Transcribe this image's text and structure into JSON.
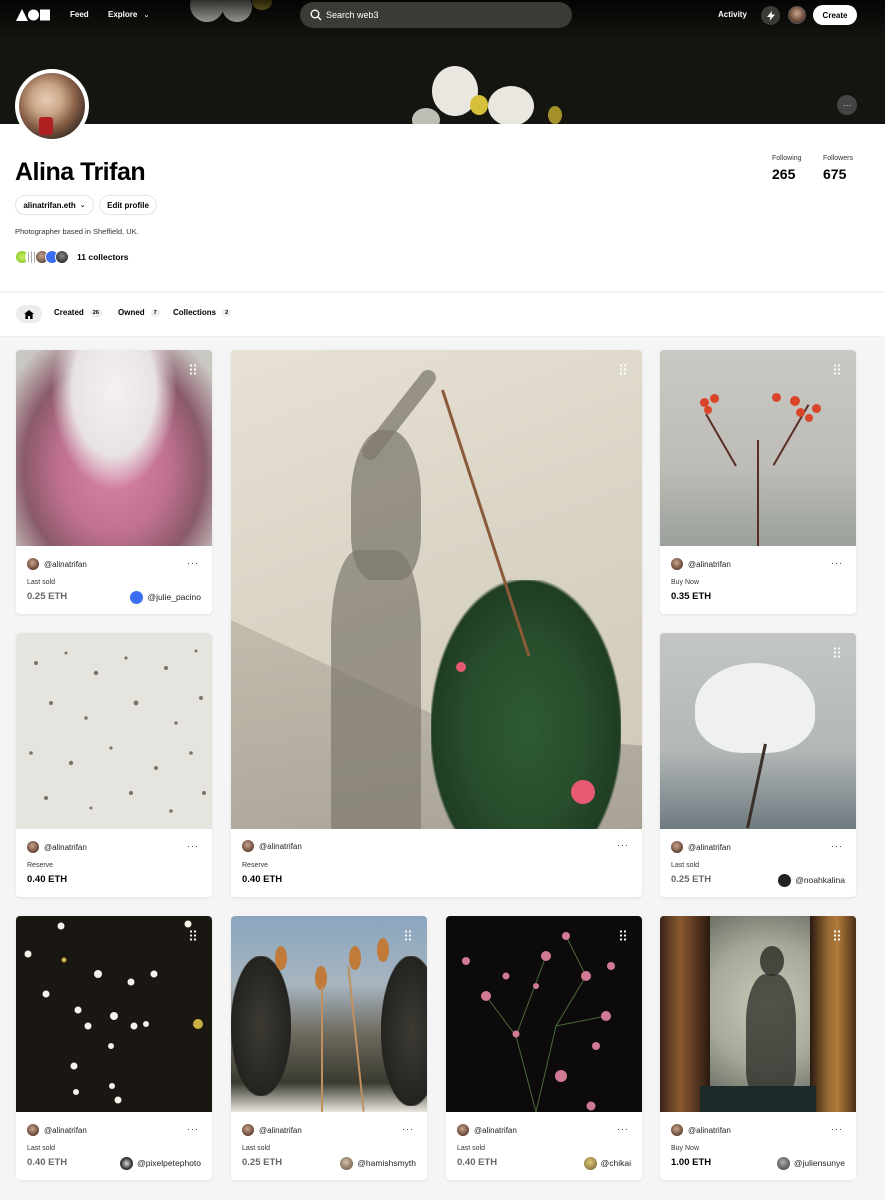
{
  "nav": {
    "feed": "Feed",
    "explore": "Explore",
    "search_placeholder": "Search web3",
    "activity": "Activity",
    "create": "Create"
  },
  "profile": {
    "name": "Alina Trifan",
    "ens": "alinatrifan.eth",
    "edit_profile": "Edit profile",
    "bio": "Photographer based in Sheffield, UK.",
    "collectors": "11 collectors",
    "following_label": "Following",
    "following": "265",
    "followers_label": "Followers",
    "followers": "675"
  },
  "tabs": {
    "created": "Created",
    "created_count": "26",
    "owned": "Owned",
    "owned_count": "7",
    "collections": "Collections",
    "collections_count": "2"
  },
  "cards": [
    {
      "creator": "@alinatrifan",
      "status": "Last sold",
      "price": "0.25 ETH",
      "owner": "@julie_pacino",
      "owner_color": "#3b6ef0",
      "image": "pink hydrangea with snow"
    },
    {
      "creator": "@alinatrifan",
      "status": "Reserve",
      "price": "0.40 ETH",
      "image": "shadow with mandevilla plant"
    },
    {
      "creator": "@alinatrifan",
      "status": "Buy Now",
      "price": "0.35 ETH",
      "image": "red berries on branch"
    },
    {
      "creator": "@alinatrifan",
      "status": "Reserve",
      "price": "0.40 ETH",
      "image": "snowy ground with seeds"
    },
    {
      "creator": "@alinatrifan",
      "status": "Last sold",
      "price": "0.25 ETH",
      "owner": "@noahkalina",
      "owner_color": "#222222",
      "image": "snow on dried umbel"
    },
    {
      "creator": "@alinatrifan",
      "status": "Last sold",
      "price": "0.40 ETH",
      "owner": "@pixelpetephoto",
      "owner_color": "#333333",
      "image": "white flowers on dark ground"
    },
    {
      "creator": "@alinatrifan",
      "status": "Last sold",
      "price": "0.25 ETH",
      "owner": "@hamishsmyth",
      "owner_color": "#6b5a4a",
      "image": "teasels at sunset"
    },
    {
      "creator": "@alinatrifan",
      "status": "Last sold",
      "price": "0.40 ETH",
      "owner": "@chikai",
      "owner_color": "#8a7a3a",
      "image": "pink verbena on black"
    },
    {
      "creator": "@alinatrifan",
      "status": "Buy Now",
      "price": "1.00 ETH",
      "owner": "@juliensunye",
      "owner_color": "#555555",
      "image": "silhouette behind curtain"
    }
  ],
  "colors": {
    "accent": "#000000",
    "background": "#f5f5f5"
  }
}
